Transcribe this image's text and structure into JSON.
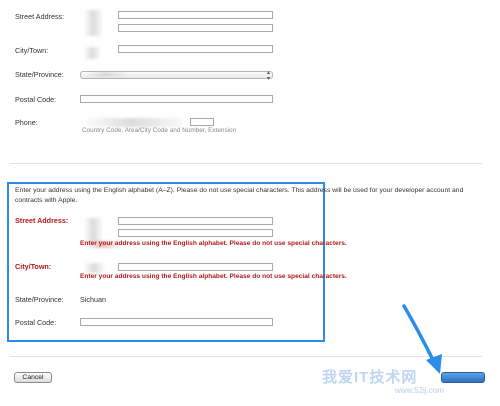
{
  "top_section": {
    "street_label": "Street Address:",
    "city_label": "City/Town:",
    "state_label": "State/Province:",
    "postal_label": "Postal Code:",
    "phone_label": "Phone:",
    "phone_hint": "Country Code, Area/City Code and Number, Extension"
  },
  "english_section": {
    "intro": "Enter your address using the English alphabet (A–Z). Please do not use special characters. This address will be used for your developer account and contracts with Apple.",
    "street_label": "Street Address:",
    "street_error": "Enter your address using the English alphabet. Please do not use special characters.",
    "city_label": "City/Town:",
    "city_error": "Enter your address using the English alphabet. Please do not use special characters.",
    "state_label": "State/Province:",
    "state_value": "Sichuan",
    "postal_label": "Postal Code:"
  },
  "buttons": {
    "cancel": "Cancel"
  },
  "watermark": {
    "main": "我爱IT技术网",
    "url": "www.52ij.com"
  },
  "colors": {
    "error": "#b01b1b",
    "highlight": "#2a8ee8",
    "arrow": "#2a8ee8"
  }
}
